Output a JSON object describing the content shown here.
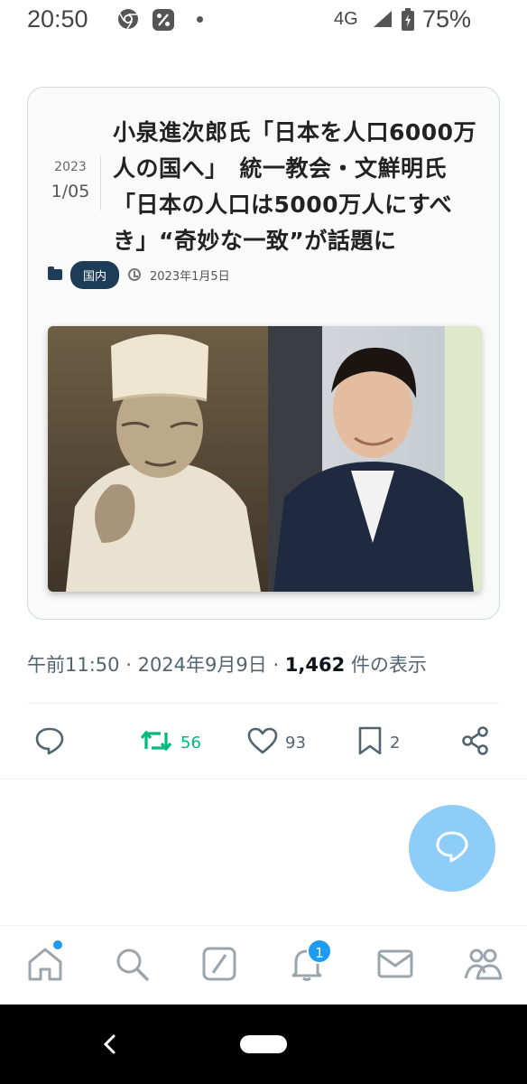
{
  "status_bar": {
    "time": "20:50",
    "network": "4G",
    "battery": "75%",
    "icons": [
      "chrome-icon",
      "percent-app-icon",
      "notification-dot",
      "signal-icon",
      "battery-charging-icon"
    ]
  },
  "article_card": {
    "date_year": "2023",
    "date_day": "1/05",
    "title": "小泉進次郎氏「日本を人口6000万人の国へ」　統一教会・文鮮明氏「日本の人口は5000万人にすべき」“奇妙な一致”が話題に",
    "category": "国内",
    "published": "2023年1月5日",
    "icons": [
      "folder-icon",
      "clock-icon"
    ]
  },
  "post_info": {
    "time": "午前11:50",
    "date": "2024年9月9日",
    "views_count": "1,462",
    "views_label": "件の表示"
  },
  "actions": {
    "reply_count": "",
    "retweet_count": "56",
    "like_count": "93",
    "bookmark_count": "2",
    "icons": [
      "reply-icon",
      "retweet-icon",
      "like-icon",
      "bookmark-icon",
      "share-icon"
    ]
  },
  "bottom_nav": {
    "notification_badge": "1",
    "items": [
      "home-icon",
      "search-icon",
      "grok-icon",
      "notifications-icon",
      "messages-icon",
      "communities-icon"
    ]
  },
  "colors": {
    "accent": "#1d9bf0",
    "retweet_green": "#00ba7c",
    "fab": "#8ecdf8",
    "tag_bg": "#1d3c57",
    "text_secondary": "#536471"
  }
}
